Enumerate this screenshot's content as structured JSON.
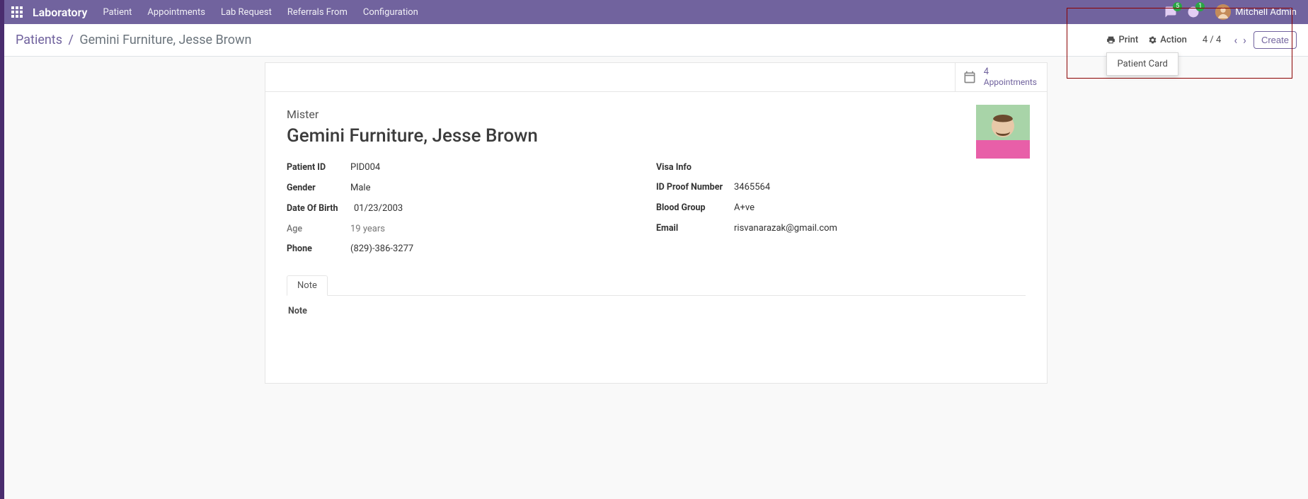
{
  "topbar": {
    "app_title": "Laboratory",
    "menu": [
      "Patient",
      "Appointments",
      "Lab Request",
      "Referrals From",
      "Configuration"
    ],
    "messages_badge": "5",
    "activities_badge": "1",
    "username": "Mitchell Admin"
  },
  "breadcrumb": {
    "root": "Patients",
    "current": "Gemini Furniture, Jesse Brown"
  },
  "controls": {
    "print_label": "Print",
    "action_label": "Action",
    "pager": "4 / 4",
    "create_label": "Create",
    "print_menu_item": "Patient Card"
  },
  "stat": {
    "count": "4",
    "label": "Appointments"
  },
  "patient": {
    "prefix": "Mister",
    "name": "Gemini Furniture, Jesse Brown",
    "labels": {
      "patient_id": "Patient ID",
      "gender": "Gender",
      "dob": "Date Of Birth",
      "age": "Age",
      "phone": "Phone",
      "visa": "Visa Info",
      "idproof": "ID Proof Number",
      "blood": "Blood Group",
      "email": "Email"
    },
    "values": {
      "patient_id": "PID004",
      "gender": "Male",
      "dob": "01/23/2003",
      "age": "19 years",
      "phone": "(829)-386-3277",
      "idproof": "3465564",
      "blood": "A+ve",
      "email": "risvanarazak@gmail.com"
    }
  },
  "tabs": {
    "note_tab": "Note",
    "note_label": "Note"
  }
}
